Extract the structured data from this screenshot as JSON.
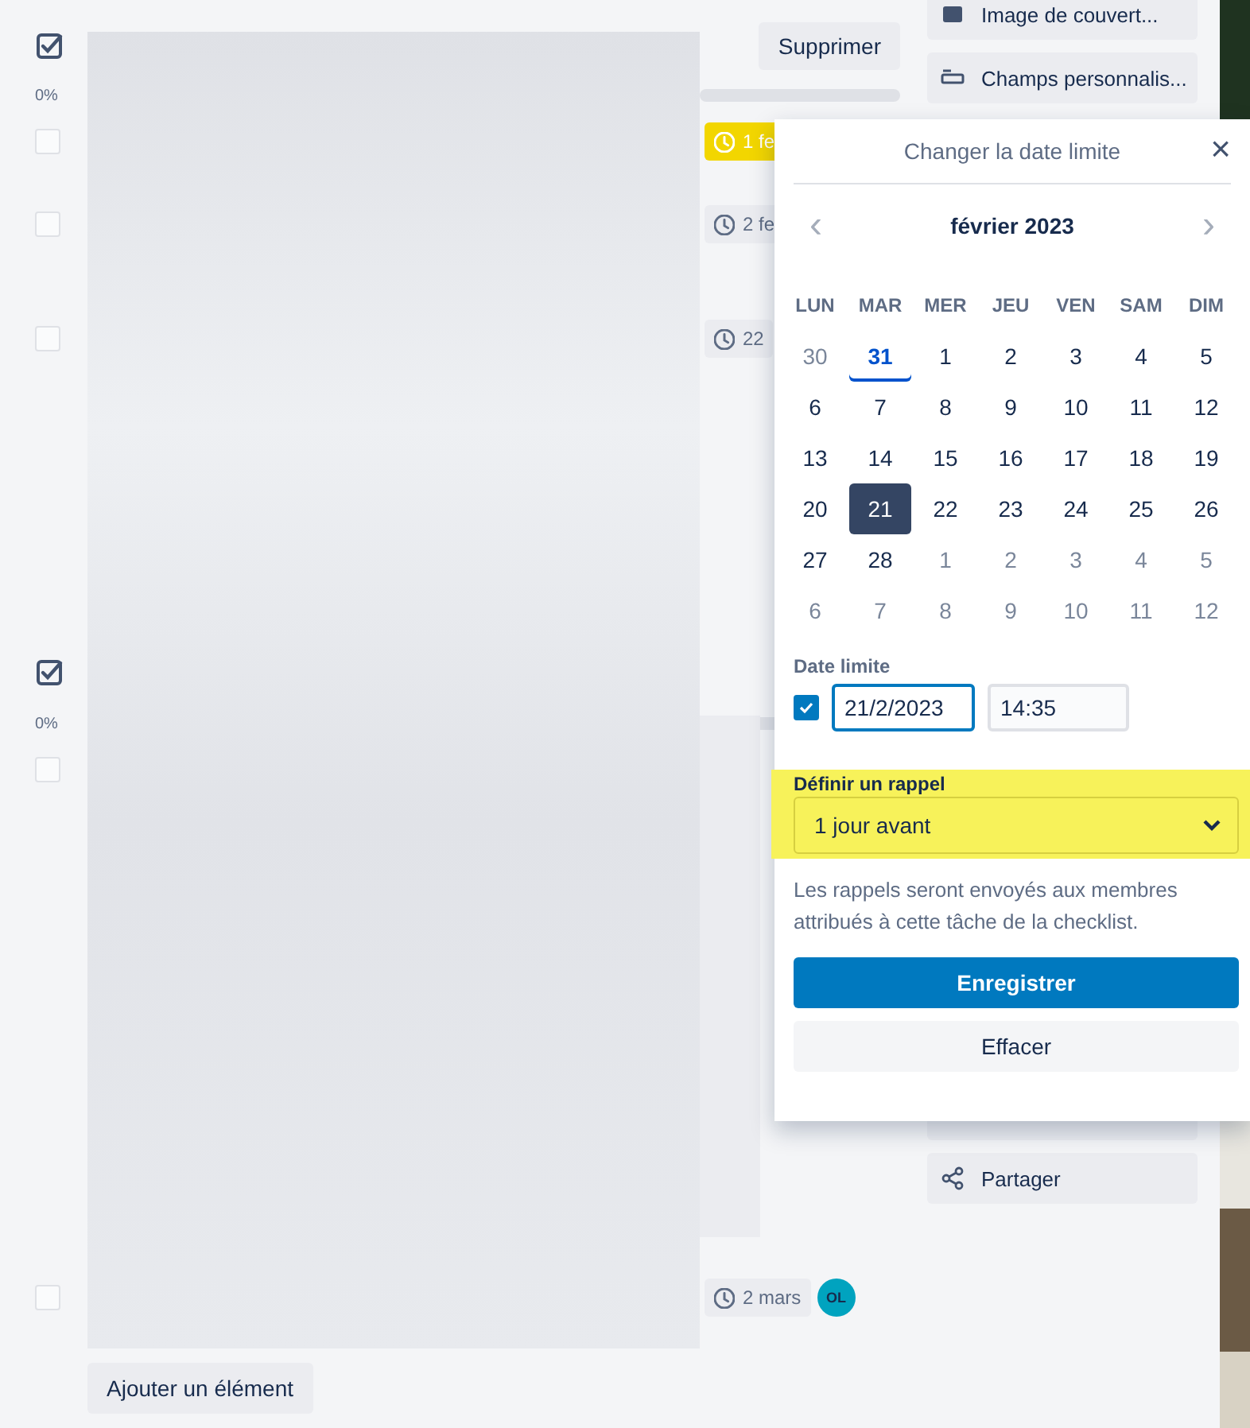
{
  "checklists": [
    {
      "progress": "0%",
      "level": 0,
      "delete_label": "Supprimer",
      "items": [
        {
          "checked": false,
          "due": "1 fe",
          "color": "#f2d600"
        },
        {
          "checked": false,
          "due": "2 fe",
          "color": "#ebecf0"
        },
        {
          "checked": false,
          "due": "22",
          "color": "#ebecf0"
        }
      ]
    },
    {
      "progress": "0%",
      "level": 0,
      "items": [
        {
          "checked": false
        },
        {
          "checked": false,
          "due": "2 mars",
          "color": "#ebecf0",
          "member": "OL"
        }
      ]
    }
  ],
  "add_item_label": "Ajouter un élément",
  "sidebar": {
    "top_actions": [
      {
        "label": "Image de couvert..."
      },
      {
        "label": "Champs personnalis..."
      }
    ],
    "bottom_actions": [
      {
        "label": "Partager"
      }
    ]
  },
  "date_popover": {
    "title": "Changer la date limite",
    "close": "×",
    "prev": "‹",
    "next": "›",
    "month": "février 2023",
    "weekdays": [
      "LUN",
      "MAR",
      "MER",
      "JEU",
      "VEN",
      "SAM",
      "DIM"
    ],
    "days": [
      {
        "label": "30",
        "muted": true,
        "today": false,
        "selected": false
      },
      {
        "label": "31",
        "muted": false,
        "today": true,
        "selected": false
      },
      {
        "label": "1",
        "muted": false,
        "today": false,
        "selected": false
      },
      {
        "label": "2",
        "muted": false,
        "today": false,
        "selected": false
      },
      {
        "label": "3",
        "muted": false,
        "today": false,
        "selected": false
      },
      {
        "label": "4",
        "muted": false,
        "today": false,
        "selected": false
      },
      {
        "label": "5",
        "muted": false,
        "today": false,
        "selected": false
      },
      {
        "label": "6",
        "muted": false,
        "today": false,
        "selected": false
      },
      {
        "label": "7",
        "muted": false,
        "today": false,
        "selected": false
      },
      {
        "label": "8",
        "muted": false,
        "today": false,
        "selected": false
      },
      {
        "label": "9",
        "muted": false,
        "today": false,
        "selected": false
      },
      {
        "label": "10",
        "muted": false,
        "today": false,
        "selected": false
      },
      {
        "label": "11",
        "muted": false,
        "today": false,
        "selected": false
      },
      {
        "label": "12",
        "muted": false,
        "today": false,
        "selected": false
      },
      {
        "label": "13",
        "muted": false,
        "today": false,
        "selected": false
      },
      {
        "label": "14",
        "muted": false,
        "today": false,
        "selected": false
      },
      {
        "label": "15",
        "muted": false,
        "today": false,
        "selected": false
      },
      {
        "label": "16",
        "muted": false,
        "today": false,
        "selected": false
      },
      {
        "label": "17",
        "muted": false,
        "today": false,
        "selected": false
      },
      {
        "label": "18",
        "muted": false,
        "today": false,
        "selected": false
      },
      {
        "label": "19",
        "muted": false,
        "today": false,
        "selected": false
      },
      {
        "label": "20",
        "muted": false,
        "today": false,
        "selected": false
      },
      {
        "label": "21",
        "muted": false,
        "today": false,
        "selected": true
      },
      {
        "label": "22",
        "muted": false,
        "today": false,
        "selected": false
      },
      {
        "label": "23",
        "muted": false,
        "today": false,
        "selected": false
      },
      {
        "label": "24",
        "muted": false,
        "today": false,
        "selected": false
      },
      {
        "label": "25",
        "muted": false,
        "today": false,
        "selected": false
      },
      {
        "label": "26",
        "muted": false,
        "today": false,
        "selected": false
      },
      {
        "label": "27",
        "muted": false,
        "today": false,
        "selected": false
      },
      {
        "label": "28",
        "muted": false,
        "today": false,
        "selected": false
      },
      {
        "label": "1",
        "muted": true,
        "today": false,
        "selected": false
      },
      {
        "label": "2",
        "muted": true,
        "today": false,
        "selected": false
      },
      {
        "label": "3",
        "muted": true,
        "today": false,
        "selected": false
      },
      {
        "label": "4",
        "muted": true,
        "today": false,
        "selected": false
      },
      {
        "label": "5",
        "muted": true,
        "today": false,
        "selected": false
      },
      {
        "label": "6",
        "muted": true,
        "today": false,
        "selected": false
      },
      {
        "label": "7",
        "muted": true,
        "today": false,
        "selected": false
      },
      {
        "label": "8",
        "muted": true,
        "today": false,
        "selected": false
      },
      {
        "label": "9",
        "muted": true,
        "today": false,
        "selected": false
      },
      {
        "label": "10",
        "muted": true,
        "today": false,
        "selected": false
      },
      {
        "label": "11",
        "muted": true,
        "today": false,
        "selected": false
      },
      {
        "label": "12",
        "muted": true,
        "today": false,
        "selected": false
      }
    ],
    "due_label": "Date limite",
    "due_enabled": true,
    "date_value": "21/2/2023",
    "time_value": "14:35",
    "reminder_label": "Définir un rappel",
    "reminder_value": "1 jour avant",
    "reminder_highlighted": true,
    "reminder_note": "Les rappels seront envoyés aux membres attribués à cette tâche de la checklist.",
    "save_label": "Enregistrer",
    "clear_label": "Effacer"
  }
}
